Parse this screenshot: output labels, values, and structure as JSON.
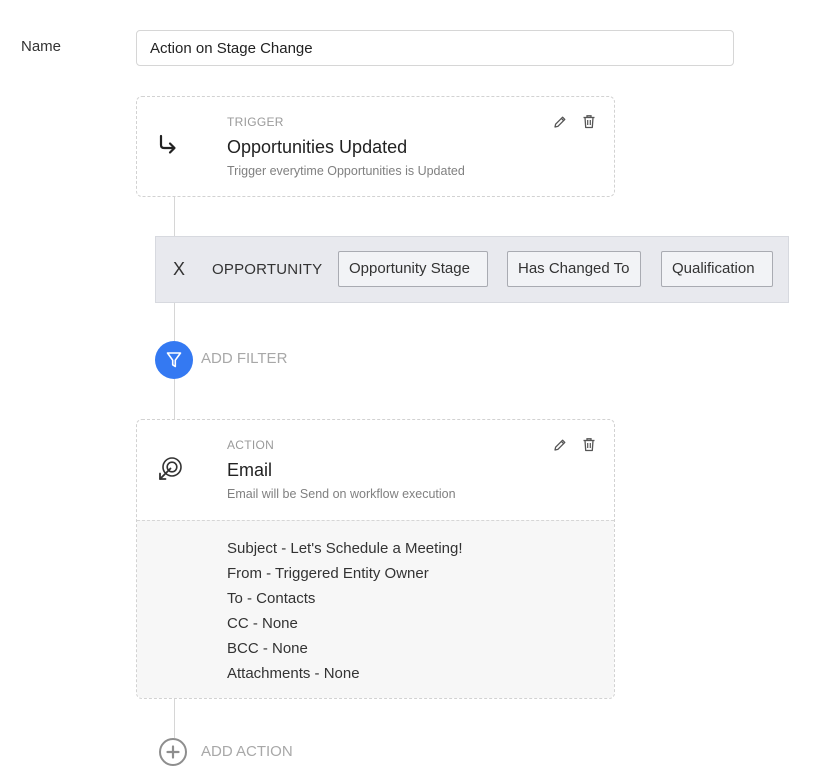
{
  "form": {
    "name_label": "Name",
    "name_value": "Action on Stage Change"
  },
  "trigger": {
    "kicker": "TRIGGER",
    "title": "Opportunities Updated",
    "subtitle": "Trigger everytime Opportunities is Updated",
    "icon": "arrow-turn-right-icon"
  },
  "filter": {
    "remove_label": "X",
    "entity": "OPPORTUNITY",
    "field": "Opportunity Stage",
    "operator": "Has Changed To",
    "value": "Qualification"
  },
  "add_filter": {
    "label": "ADD FILTER",
    "icon": "funnel-icon",
    "color": "#3479f2"
  },
  "action": {
    "kicker": "ACTION",
    "title": "Email",
    "subtitle": "Email will be Send on workflow execution",
    "icon": "target-arrow-icon",
    "details": [
      "Subject - Let's Schedule a Meeting!",
      "From - Triggered Entity Owner",
      "To - Contacts",
      "CC - None",
      "BCC - None",
      "Attachments - None"
    ]
  },
  "add_action": {
    "label": "ADD ACTION",
    "icon": "plus-circle-icon"
  }
}
